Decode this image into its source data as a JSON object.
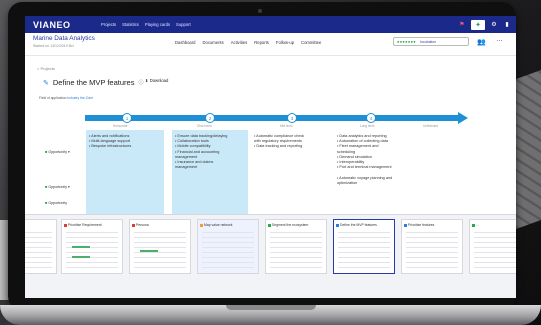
{
  "app": {
    "logo": "VIANEO",
    "nav": [
      "Projects",
      "Statistics",
      "Playing cards",
      "Support"
    ]
  },
  "project": {
    "title": "Marine Data Analytics",
    "subtitle": "Started on 13/12/2019 Bcl",
    "tabs": [
      "Dashboard",
      "Documents",
      "Activities",
      "Reports",
      "Follow-up",
      "Committee"
    ],
    "status_label": "Incubation",
    "status_dots": "●●●●●●●"
  },
  "page": {
    "back": "< Projects",
    "feature_title": "Define the MVP features",
    "download": "Download",
    "application_label": "Field of application",
    "application_value": "Industry the Zone"
  },
  "roadmap": {
    "nodes": [
      "1",
      "2",
      "3",
      "4"
    ],
    "columns": [
      "Horizontal",
      "Short term",
      "Mid term",
      "Long term",
      "Unfinished"
    ],
    "col1": [
      "• Alerts and notifications",
      "• Multi-language support",
      "• Bespoke infrastructures"
    ],
    "col2": [
      "• Ensure data tracking/delaying",
      "• Collaboration tools",
      "• Mobile compatibility",
      "• Financial and accounting",
      "  management",
      "• Insurance and claims",
      "  management"
    ],
    "col3": [
      "• Automatic compliance check",
      "  with regulatory requirements",
      "• Data tracking and reporting"
    ],
    "col4": [
      "• Data analytics and reporting",
      "• Automation of collecting data",
      "• Fleet management and",
      "  scheduling",
      "• Demand simulation",
      "• Interoperability",
      "• Port and terminal management",
      "",
      "• Automatic voyage planning and",
      "  optimization"
    ],
    "opportunities": [
      "Opportunity ▾",
      "Opportunity ▾",
      "Opportunity"
    ]
  },
  "thumbnails": [
    {
      "label": "...",
      "color": "#2aa84a"
    },
    {
      "label": "Prioritise Requirement",
      "color": "#e03a3a"
    },
    {
      "label": "Persona",
      "color": "#e03a3a"
    },
    {
      "label": "Map value network",
      "color": "#f0a030"
    },
    {
      "label": "Segment the ecosystem",
      "color": "#2aa84a"
    },
    {
      "label": "Define the MVP features",
      "color": "#2b7fd6"
    },
    {
      "label": "Prioritise features",
      "color": "#2b7fd6"
    },
    {
      "label": "...",
      "color": "#2aa84a"
    }
  ],
  "colors": {
    "topbar": "#1b2a8a",
    "accent": "#1f8fd6",
    "highlight": "#c9e8f8"
  }
}
